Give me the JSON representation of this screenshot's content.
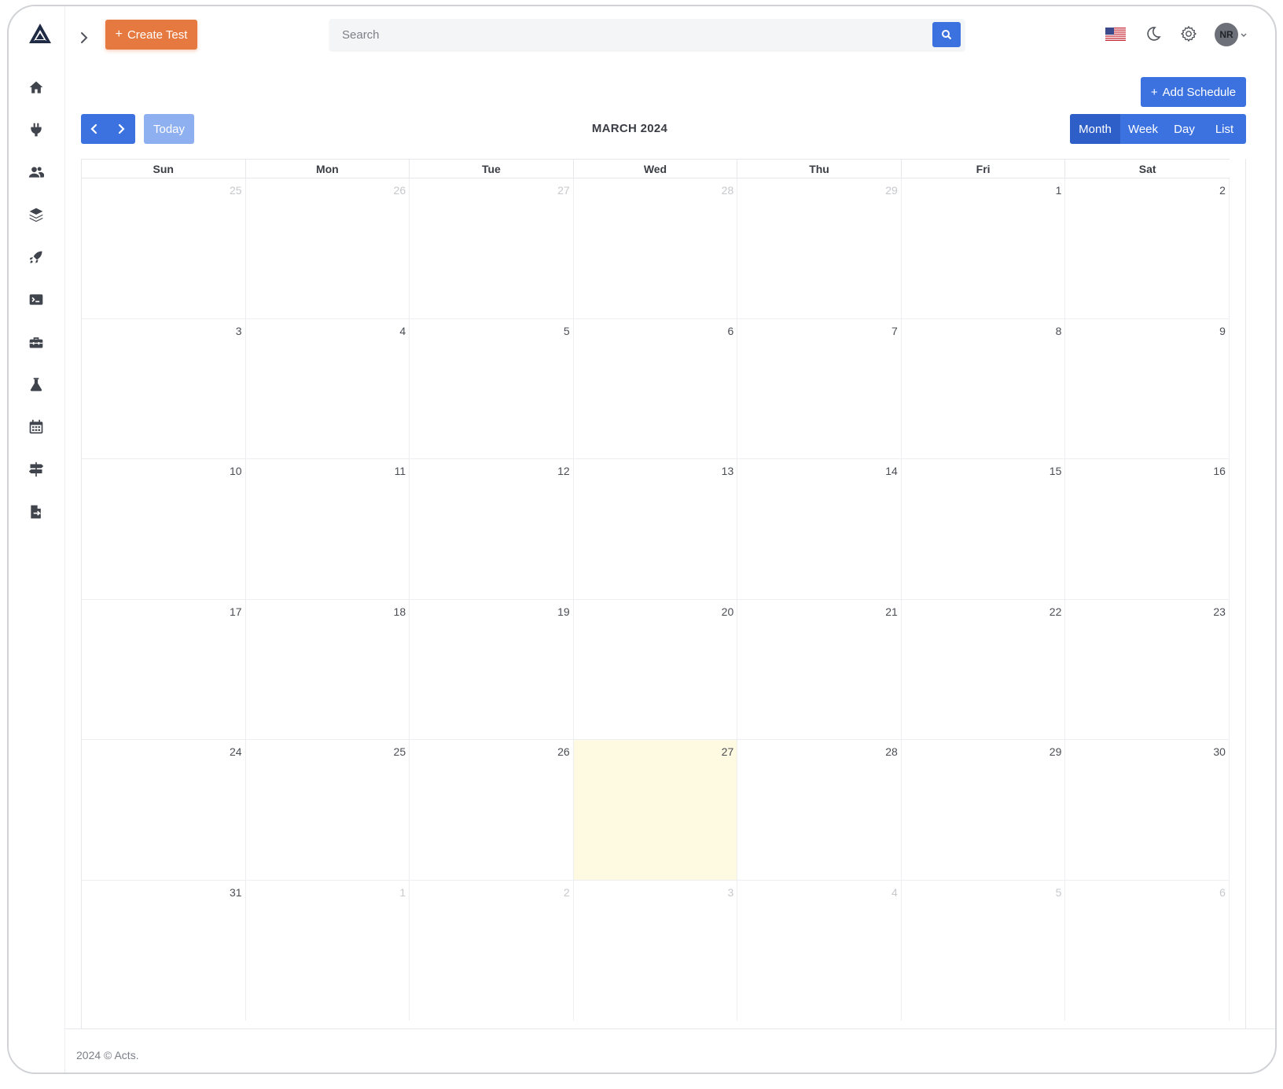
{
  "header": {
    "create_label": "Create Test",
    "search_placeholder": "Search",
    "avatar_initials": "NR"
  },
  "sidebar": {
    "items": [
      "home-icon",
      "plug-icon",
      "users-icon",
      "layers-icon",
      "rocket-icon",
      "terminal-icon",
      "toolbox-icon",
      "flask-icon",
      "calendar-icon",
      "signs-icon",
      "file-export-icon"
    ]
  },
  "calendar": {
    "add_label": "Add Schedule",
    "today_label": "Today",
    "title": "MARCH 2024",
    "views": [
      {
        "label": "Month",
        "active": true
      },
      {
        "label": "Week",
        "active": false
      },
      {
        "label": "Day",
        "active": false
      },
      {
        "label": "List",
        "active": false
      }
    ],
    "weekdays": [
      "Sun",
      "Mon",
      "Tue",
      "Wed",
      "Thu",
      "Fri",
      "Sat"
    ],
    "weeks": [
      [
        {
          "d": "25",
          "o": true
        },
        {
          "d": "26",
          "o": true
        },
        {
          "d": "27",
          "o": true
        },
        {
          "d": "28",
          "o": true
        },
        {
          "d": "29",
          "o": true
        },
        {
          "d": "1"
        },
        {
          "d": "2"
        }
      ],
      [
        {
          "d": "3"
        },
        {
          "d": "4"
        },
        {
          "d": "5"
        },
        {
          "d": "6"
        },
        {
          "d": "7"
        },
        {
          "d": "8"
        },
        {
          "d": "9"
        }
      ],
      [
        {
          "d": "10"
        },
        {
          "d": "11"
        },
        {
          "d": "12"
        },
        {
          "d": "13"
        },
        {
          "d": "14"
        },
        {
          "d": "15"
        },
        {
          "d": "16"
        }
      ],
      [
        {
          "d": "17"
        },
        {
          "d": "18"
        },
        {
          "d": "19"
        },
        {
          "d": "20"
        },
        {
          "d": "21"
        },
        {
          "d": "22"
        },
        {
          "d": "23"
        }
      ],
      [
        {
          "d": "24"
        },
        {
          "d": "25"
        },
        {
          "d": "26"
        },
        {
          "d": "27",
          "t": true
        },
        {
          "d": "28"
        },
        {
          "d": "29"
        },
        {
          "d": "30"
        }
      ],
      [
        {
          "d": "31"
        },
        {
          "d": "1",
          "o": true
        },
        {
          "d": "2",
          "o": true
        },
        {
          "d": "3",
          "o": true
        },
        {
          "d": "4",
          "o": true
        },
        {
          "d": "5",
          "o": true
        },
        {
          "d": "6",
          "o": true
        }
      ]
    ]
  },
  "footer": {
    "text": "2024 © Acts."
  },
  "colors": {
    "primary": "#3c72e0",
    "accent": "#e6793f",
    "today_bg": "#fef9e1"
  }
}
